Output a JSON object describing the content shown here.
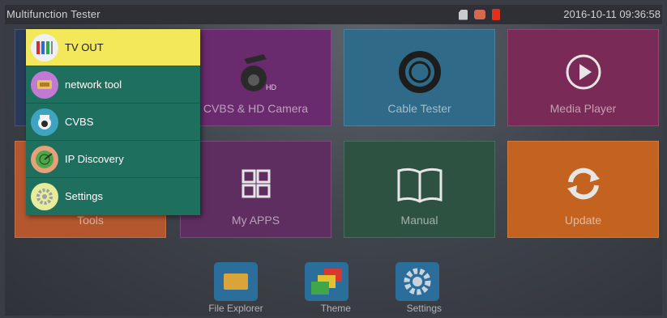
{
  "statusbar": {
    "app_title": "Multifunction Tester",
    "datetime": "2016-10-11 09:36:58",
    "icons": [
      "sd-card-icon",
      "network-icon",
      "battery-icon"
    ]
  },
  "tiles": {
    "cvbs_hd_camera": "CVBS & HD Camera",
    "cable_tester": "Cable Tester",
    "media_player": "Media Player",
    "tools": "Tools",
    "my_apps": "My APPS",
    "manual": "Manual",
    "update": "Update"
  },
  "dock": {
    "file_explorer": "File Explorer",
    "theme": "Theme",
    "settings": "Settings"
  },
  "popup_menu": {
    "items": [
      {
        "label": "TV OUT",
        "icon": "tv-out-icon",
        "selected": true
      },
      {
        "label": "network tool",
        "icon": "network-tool-icon",
        "selected": false
      },
      {
        "label": "CVBS",
        "icon": "camera-icon",
        "selected": false
      },
      {
        "label": "IP Discovery",
        "icon": "ip-discovery-icon",
        "selected": false
      },
      {
        "label": "Settings",
        "icon": "settings-icon",
        "selected": false
      }
    ]
  },
  "colors": {
    "selected_highlight": "#f2e85a",
    "menu_background": "#1e6f5e"
  }
}
